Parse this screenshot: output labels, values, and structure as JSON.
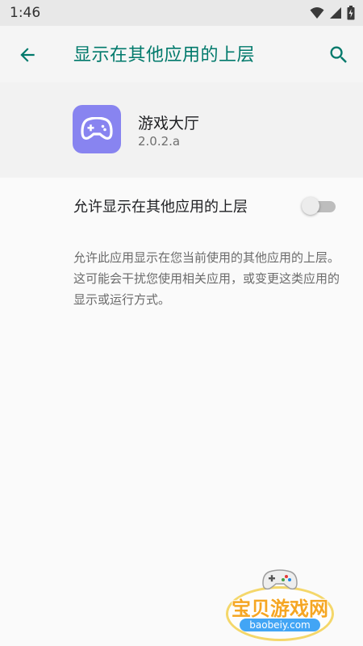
{
  "status_bar": {
    "time": "1:46",
    "icons": [
      "wifi-icon",
      "signal-icon",
      "battery-icon"
    ]
  },
  "app_bar": {
    "title": "显示在其他应用的上层",
    "back_icon": "arrow-back-icon",
    "search_icon": "search-icon",
    "accent_color": "#00796b"
  },
  "app_info": {
    "name": "游戏大厅",
    "version": "2.0.2.a",
    "icon": "gamepad-icon",
    "icon_color": "#8884f0"
  },
  "setting": {
    "label": "允许显示在其他应用的上层",
    "enabled": false,
    "description": "允许此应用显示在您当前使用的其他应用的上层。这可能会干扰您使用相关应用，或变更这类应用的显示或运行方式。"
  },
  "watermark": {
    "text": "宝贝游戏网",
    "url": "baobeiy.com"
  }
}
